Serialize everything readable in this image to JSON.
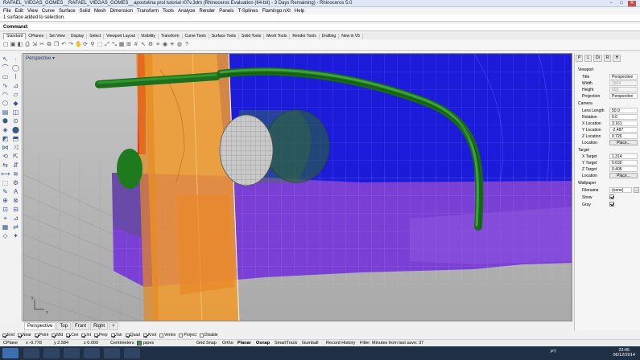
{
  "window": {
    "title": "RAFAEL_VIEGAS_GOMES__RAFAEL_VIEGAS_GOMES__apostolina prol tutorial r07v.3dm  (Rhinoceros Evaluation (64-bit) - 3 Days Remaining)  - Rhinoceros 5.0",
    "minimize": "–",
    "maximize": "□",
    "close": "✕"
  },
  "menu": [
    "File",
    "Edit",
    "View",
    "Curve",
    "Surface",
    "Solid",
    "Mesh",
    "Dimension",
    "Transform",
    "Tools",
    "Analyze",
    "Render",
    "Panels",
    "T-Splines",
    "Flamingo nXt",
    "Help"
  ],
  "command": {
    "history": "1 surface added to selection.",
    "prompt": "Command:"
  },
  "toolbar_tabs": [
    "Standard",
    "CPlanes",
    "Set View",
    "Display",
    "Select",
    "Viewport Layout",
    "Visibility",
    "Transform",
    "Curve Tools",
    "Surface Tools",
    "Solid Tools",
    "Mesh Tools",
    "Render Tools",
    "Drafting",
    "New in V5"
  ],
  "toolbar_icons": [
    "new-icon",
    "open-icon",
    "save-icon",
    "print-icon",
    "import-icon",
    "cut-icon",
    "copy-icon",
    "paste-icon",
    "undo-icon",
    "redo-icon",
    "pan-icon",
    "rotate-view-icon",
    "zoom-icon",
    "zoom-window-icon",
    "zoom-extents-icon",
    "zoom-selected-icon",
    "four-views-icon",
    "cplane-icon",
    "grid-icon",
    "select-icon",
    "object-properties-icon",
    "layer-icon",
    "render-icon",
    "lights-icon",
    "materials-icon",
    "help-icon"
  ],
  "toolbar_glyphs": [
    "▢",
    "▣",
    "◧",
    "⎙",
    "⇲",
    "✂",
    "⧉",
    "❐",
    "↶",
    "↷",
    "✋",
    "⟳",
    "⚲",
    "⬚",
    "⤢",
    "⤡",
    "▦",
    "⊞",
    "#",
    "↖",
    "⚙",
    "≡",
    "◉",
    "☀",
    "◍",
    "?"
  ],
  "left_tools": [
    "↖",
    "·",
    "⌒",
    "◯",
    "▭",
    "⌇",
    "∿",
    "⊿",
    "◠",
    "▱",
    "⬡",
    "◆",
    "▤",
    "◫",
    "⬢",
    "⊙",
    "◈",
    "⬤",
    "◩",
    "⬒",
    "⋈",
    "⤨",
    "⟲",
    "⇱",
    "⇆",
    "⇵",
    "⟷",
    "≋",
    "⬚",
    "⚙",
    "✎",
    "A",
    "⊕",
    "⊗",
    "⊡",
    "⊟",
    "⌖",
    "⊿",
    "▦",
    "⇄",
    "◇",
    "✦"
  ],
  "viewport": {
    "label": "Perspective",
    "label_arrow": "▾",
    "axis_x": "x",
    "axis_y": "y"
  },
  "viewport_tabs": [
    "Perspective",
    "Top",
    "Front",
    "Right",
    "+"
  ],
  "osnap": [
    {
      "label": "End",
      "on": true
    },
    {
      "label": "Near",
      "on": true
    },
    {
      "label": "Point",
      "on": true
    },
    {
      "label": "Mid",
      "on": true
    },
    {
      "label": "Cen",
      "on": true
    },
    {
      "label": "Int",
      "on": true
    },
    {
      "label": "Perp",
      "on": true
    },
    {
      "label": "Tan",
      "on": true
    },
    {
      "label": "Quad",
      "on": true
    },
    {
      "label": "Knot",
      "on": true
    },
    {
      "label": "Vertex",
      "on": false
    },
    {
      "label": "Project",
      "on": false
    },
    {
      "label": "Disable",
      "on": false
    }
  ],
  "status": {
    "cplane": "CPlane",
    "x": "x -0.778",
    "y": "y 2.584",
    "z": "z 0.000",
    "units": "Centimeters",
    "layer": "pipes",
    "grid_snap": "Grid Snap",
    "ortho": "Ortho",
    "planar": "Planar",
    "osnap": "Osnap",
    "smarttrack": "SmartTrack",
    "gumball": "Gumball",
    "record_history": "Record History",
    "filter": "Filter",
    "save_msg": "Minutes from last save: 37",
    "layer_color": "#3a9b3a"
  },
  "panel": {
    "tabs": [
      "P",
      "L",
      "Di",
      "R",
      "H"
    ],
    "viewport_section": "Viewport",
    "viewport_rows": [
      {
        "key": "Title",
        "value": "Perspective",
        "dim": false
      },
      {
        "key": "Width",
        "value": "1604",
        "dim": true
      },
      {
        "key": "Height",
        "value": "603",
        "dim": true
      },
      {
        "key": "Projection",
        "value": "Perspective",
        "dim": false
      }
    ],
    "camera_section": "Camera",
    "camera_rows": [
      {
        "key": "Lens Length",
        "value": "50.0"
      },
      {
        "key": "Rotation",
        "value": "0.0"
      },
      {
        "key": "X Location",
        "value": "3.161"
      },
      {
        "key": "Y Location",
        "value": "-2.487"
      },
      {
        "key": "Z Location",
        "value": "0.726"
      }
    ],
    "camera_location_label": "Location",
    "place_button": "Place...",
    "target_section": "Target",
    "target_rows": [
      {
        "key": "X Target",
        "value": "1.314"
      },
      {
        "key": "Y Target",
        "value": "0.630"
      },
      {
        "key": "Z Target",
        "value": "0.405"
      }
    ],
    "target_location_label": "Location",
    "wallpaper_section": "Wallpaper",
    "wallpaper_rows": [
      {
        "key": "Filename",
        "value": "(none)"
      },
      {
        "key": "Show",
        "checked": true
      },
      {
        "key": "Gray",
        "checked": true
      }
    ],
    "browse_button": "..."
  },
  "taskbar": {
    "time": "23:05",
    "date": "06/12/2014",
    "lang": "PT"
  },
  "colors": {
    "blue": "#1c1cd6",
    "purple": "#7b3fd2",
    "orange": "#f09a2a",
    "green": "#1e7a1e",
    "red": "#e02020",
    "gray": "#b8b8b8"
  }
}
